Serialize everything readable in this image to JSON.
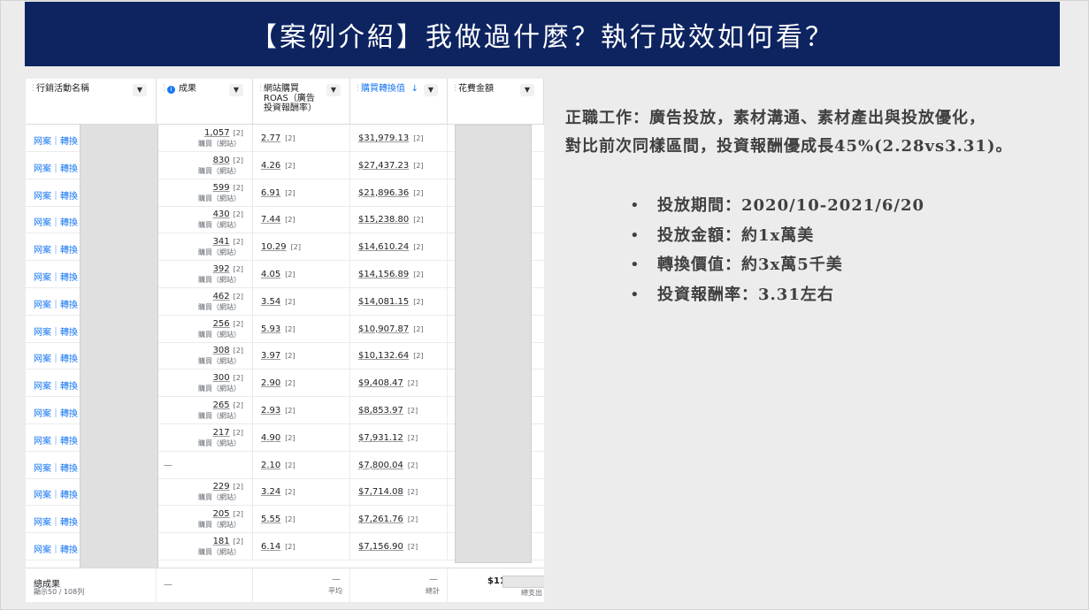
{
  "title": "【案例介紹】我做過什麼？執行成效如何看？",
  "table": {
    "headers": {
      "campaign": "行銷活動名稱",
      "results": "成果",
      "roas": "網站購買 ROAS（廣告投資報酬率）",
      "conv_value": "購買轉換值",
      "spend": "花費金額"
    },
    "sort_indicator": "↓",
    "results_sub": "購買（網站）",
    "footnote": "[2]",
    "rows": [
      {
        "name": "网案｜轉換",
        "result": "1,057",
        "roas": "2.77",
        "value": "$31,979.13"
      },
      {
        "name": "网案｜轉換",
        "result": "830",
        "roas": "4.26",
        "value": "$27,437.23"
      },
      {
        "name": "网案｜轉換",
        "result": "599",
        "roas": "6.91",
        "value": "$21,896.36"
      },
      {
        "name": "网案｜轉換",
        "result": "430",
        "roas": "7.44",
        "value": "$15,238.80"
      },
      {
        "name": "网案｜轉換",
        "result": "341",
        "roas": "10.29",
        "value": "$14,610.24"
      },
      {
        "name": "网案｜轉換",
        "result": "392",
        "roas": "4.05",
        "value": "$14,156.89"
      },
      {
        "name": "网案｜轉換",
        "result": "462",
        "roas": "3.54",
        "value": "$14,081.15"
      },
      {
        "name": "网案｜轉換",
        "result": "256",
        "roas": "5.93",
        "value": "$10,907.87"
      },
      {
        "name": "网案｜轉換",
        "result": "308",
        "roas": "3.97",
        "value": "$10,132.64"
      },
      {
        "name": "网案｜轉換",
        "result": "300",
        "roas": "2.90",
        "value": "$9,408.47"
      },
      {
        "name": "网案｜轉換",
        "result": "265",
        "roas": "2.93",
        "value": "$8,853.97"
      },
      {
        "name": "网案｜轉換",
        "result": "217",
        "roas": "4.90",
        "value": "$7,931.12"
      },
      {
        "name": "网案｜轉換",
        "result": "—",
        "roas": "2.10",
        "value": "$7,800.04"
      },
      {
        "name": "网案｜轉換",
        "result": "229",
        "roas": "3.24",
        "value": "$7,714.08"
      },
      {
        "name": "网案｜轉換",
        "result": "205",
        "roas": "5.55",
        "value": "$7,261.76"
      },
      {
        "name": "网案｜轉換",
        "result": "181",
        "roas": "6.14",
        "value": "$7,156.90"
      }
    ],
    "footer": {
      "total_label": "總成果",
      "rows_shown": "顯示50 / 108列",
      "results_dash": "—",
      "roas_dash": "—",
      "roas_note": "平均",
      "conv_dash": "—",
      "conv_note": "總計",
      "spend_prefix": "$11",
      "spend_note": "總支出"
    }
  },
  "description_line1": "正職工作：廣告投放，素材溝通、素材產出與投放優化，",
  "description_line2": "對比前次同樣區間，投資報酬優成長45%(2.28vs3.31)。",
  "bullets": [
    "投放期間：2020/10-2021/6/20",
    "投放金額：約1x萬美",
    "轉換價值：約3x萬5千美",
    "投資報酬率：3.31左右"
  ]
}
